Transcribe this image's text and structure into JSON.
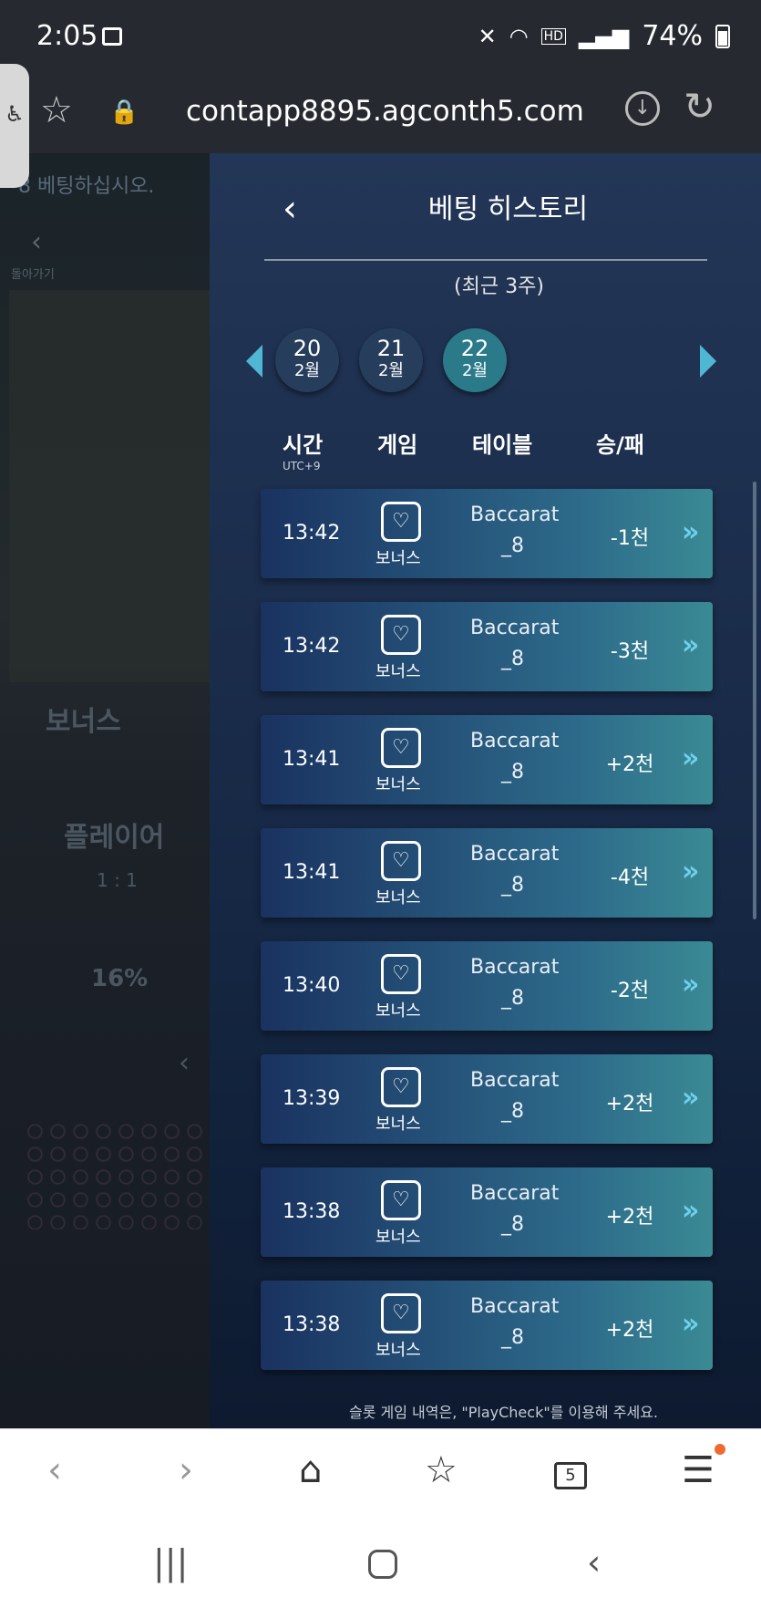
{
  "status": {
    "time": "2:05",
    "battery": "74%",
    "hd_label": "HD"
  },
  "browser": {
    "url": "contapp8895.agconth5.com",
    "tab_count": "5"
  },
  "background": {
    "message": "8  베팅하십시오.",
    "back_label": "돌아가기",
    "bonus": "보너스",
    "player": "플레이어",
    "ratio": "1 : 1",
    "percent": "16%"
  },
  "panel": {
    "title": "베팅 히스토리",
    "subtitle": "(최근 3주)",
    "dates": [
      {
        "day": "20",
        "month": "2월"
      },
      {
        "day": "21",
        "month": "2월"
      },
      {
        "day": "22",
        "month": "2월"
      }
    ],
    "columns": {
      "time": "시간",
      "tz": "UTC+9",
      "game": "게임",
      "table": "테이블",
      "result": "승/패"
    },
    "rows": [
      {
        "time": "13:42",
        "game": "보너스",
        "table1": "Baccarat",
        "table2": "_8",
        "result": "-1천"
      },
      {
        "time": "13:42",
        "game": "보너스",
        "table1": "Baccarat",
        "table2": "_8",
        "result": "-3천"
      },
      {
        "time": "13:41",
        "game": "보너스",
        "table1": "Baccarat",
        "table2": "_8",
        "result": "+2천"
      },
      {
        "time": "13:41",
        "game": "보너스",
        "table1": "Baccarat",
        "table2": "_8",
        "result": "-4천"
      },
      {
        "time": "13:40",
        "game": "보너스",
        "table1": "Baccarat",
        "table2": "_8",
        "result": "-2천"
      },
      {
        "time": "13:39",
        "game": "보너스",
        "table1": "Baccarat",
        "table2": "_8",
        "result": "+2천"
      },
      {
        "time": "13:38",
        "game": "보너스",
        "table1": "Baccarat",
        "table2": "_8",
        "result": "+2천"
      },
      {
        "time": "13:38",
        "game": "보너스",
        "table1": "Baccarat",
        "table2": "_8",
        "result": "+2천"
      }
    ],
    "footer": "슬롯 게임 내역은, \"PlayCheck\"를 이용해 주세요."
  },
  "colors": {
    "accent": "#4fb7d3",
    "active_date": "#2a7a8a",
    "notification": "#f06a30"
  }
}
